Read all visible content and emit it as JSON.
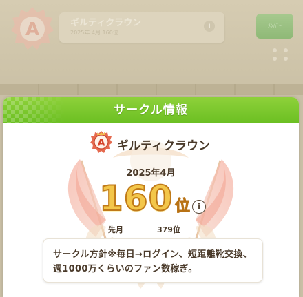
{
  "background": {
    "circle_name": "ギルティクラウン",
    "subline": "2025年 4月  160位",
    "info_glyph": "i",
    "green_button_label": "ﾒﾝﾊﾞｰ"
  },
  "dialog": {
    "title": "サークル情報",
    "circle_name": "ギルティクラウン",
    "emblem_letter": "A",
    "season": "2025年4月",
    "rank_number": "160",
    "rank_suffix": "位",
    "info_glyph": "i",
    "previous_label": "先月",
    "previous_rank": "379位",
    "policy_text": "サークル方針※毎日→ログイン、短距離靴交換、週1000万くらいのファン数稼ぎ。"
  },
  "colors": {
    "header_green": "#7cc82e",
    "rank_gold": "#f3c64a",
    "flag_red": "#f08a78",
    "text_brown": "#4a3a2a"
  }
}
